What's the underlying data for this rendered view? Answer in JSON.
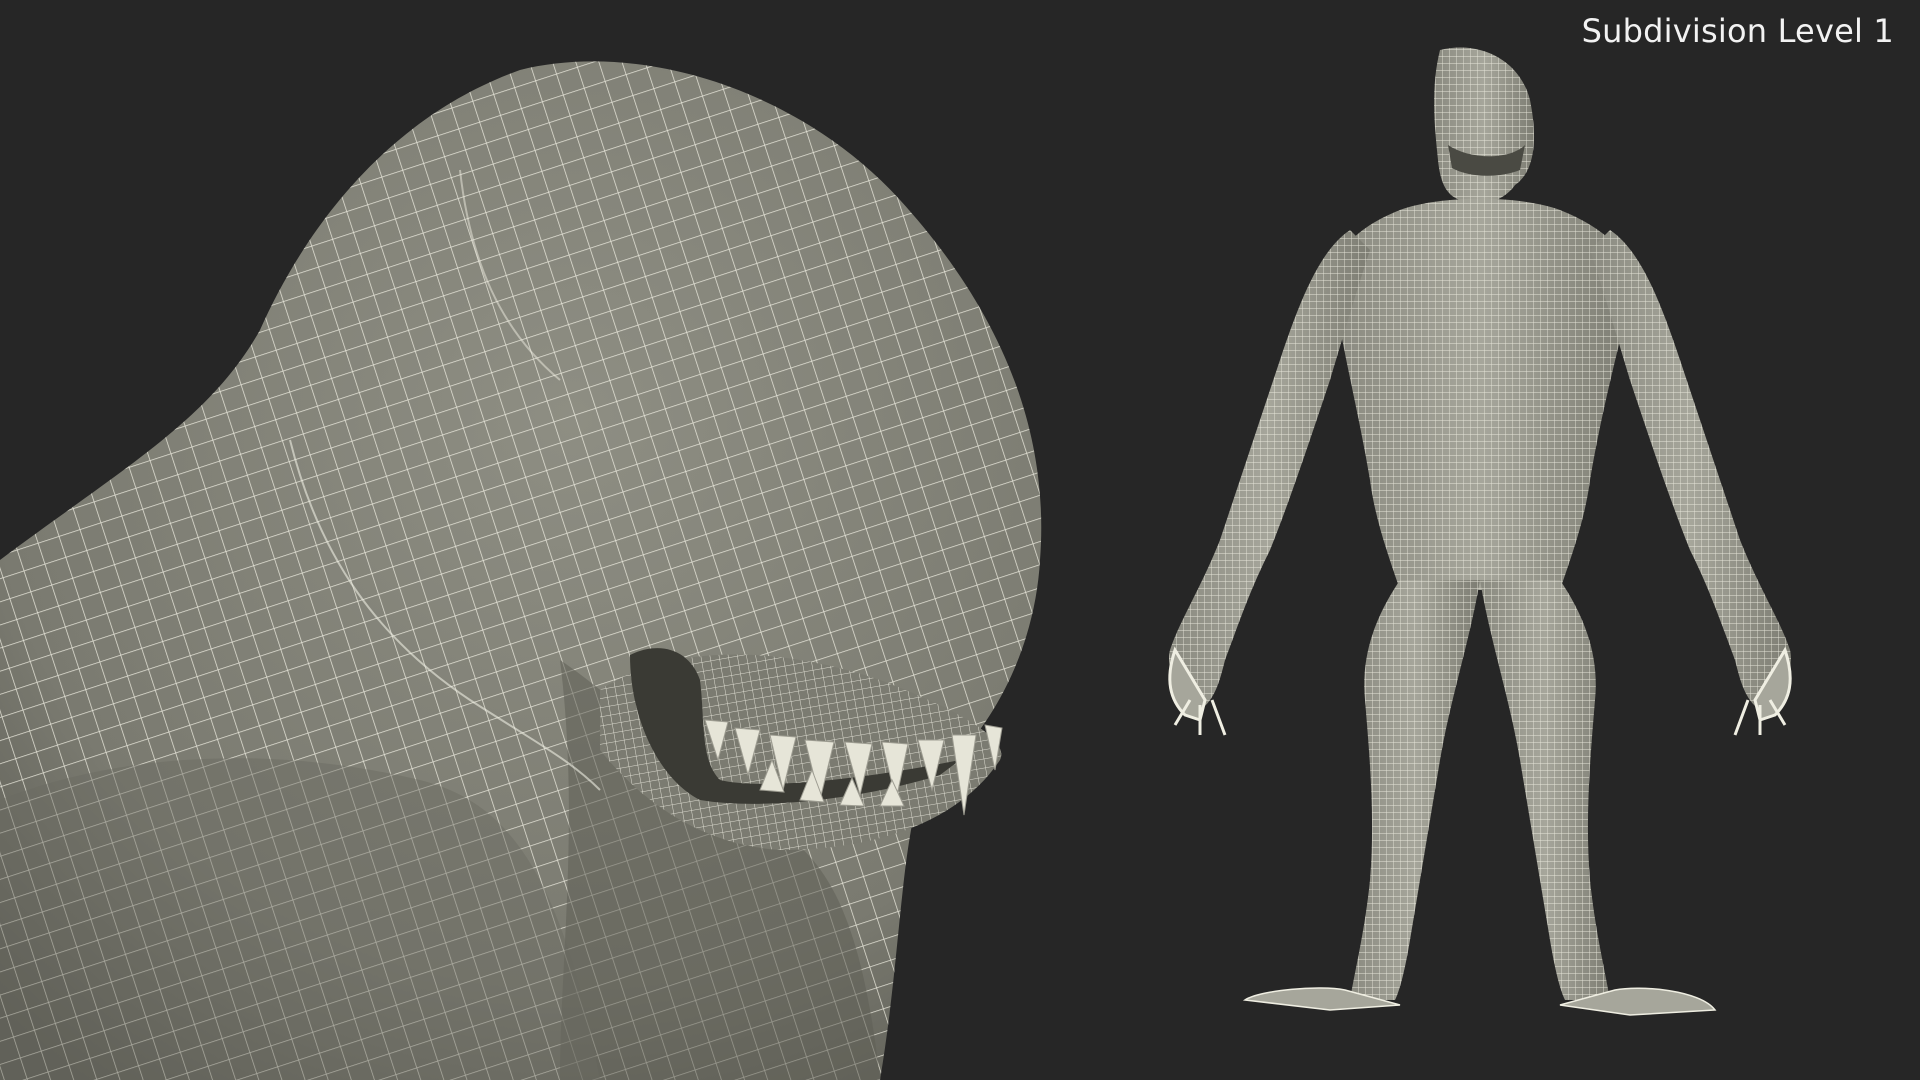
{
  "viewport": {
    "label": "Subdivision Level 1",
    "background_color": "#262626"
  },
  "model": {
    "surface_color": "#85857a",
    "wire_color": "#efeee2",
    "shadow_color": "#56564d"
  }
}
